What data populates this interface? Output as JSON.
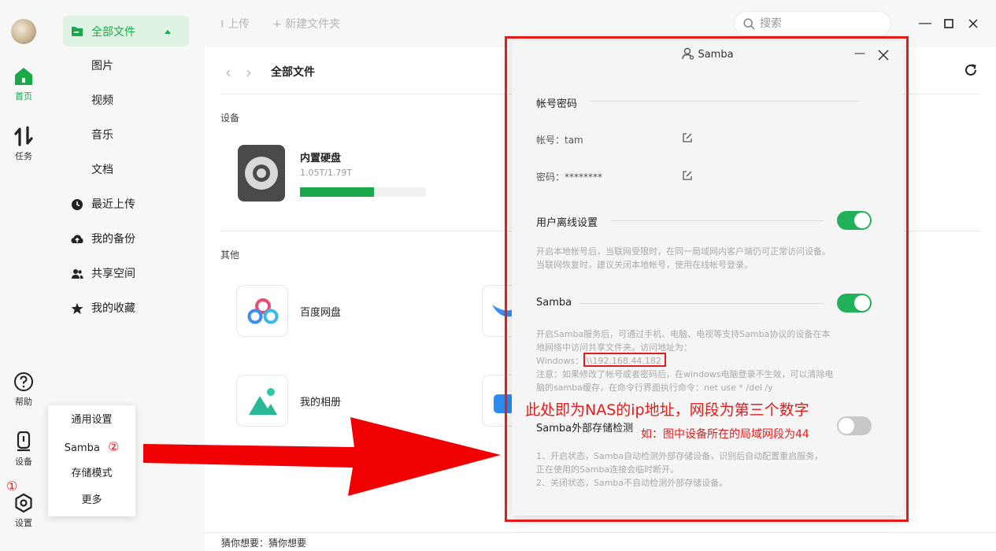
{
  "rail": {
    "items": [
      {
        "label": "首页"
      },
      {
        "label": "任务"
      },
      {
        "label": "帮助"
      },
      {
        "label": "设备"
      },
      {
        "label": "设置"
      }
    ],
    "marker_1": "①"
  },
  "sidebar": {
    "active": "全部文件",
    "sub_items": [
      "图片",
      "视频",
      "音乐",
      "文档"
    ],
    "items": [
      "最近上传",
      "我的备份",
      "共享空间",
      "我的收藏"
    ]
  },
  "toolbar": {
    "upload": "上传",
    "new_folder": "新建文件夹",
    "search_placeholder": "搜索"
  },
  "content": {
    "breadcrumb": "全部文件",
    "devices_section": "设备",
    "disk_name": "内置硬盘",
    "disk_usage": "1.05T/1.79T",
    "disk_fill": 0.59,
    "others_section": "其他",
    "apps": [
      "百度网盘",
      "我的相册"
    ],
    "hint": "猜你想要：猜你想要"
  },
  "popup": {
    "items": [
      "通用设置",
      "Samba",
      "存储模式",
      "更多"
    ],
    "marker_2": "②"
  },
  "dialog": {
    "title": "Samba",
    "account_section": "帐号密码",
    "account_label": "帐号：tam",
    "password_label": "密码：********",
    "offline_title": "用户离线设置",
    "offline_desc_1": "开启本地帐号后，当联网受限时，在同一局域网内客户端仍可正常访问设备。",
    "offline_desc_2": "当联网恢复时，建议关闭本地帐号，使用在线帐号登录。",
    "samba_title": "Samba",
    "samba_desc_1": "开启Samba服务后，可通过手机、电脑、电视等支持Samba协议的设备在本",
    "samba_desc_2": "地网络中访问共享文件夹。访问地址为：",
    "samba_windows": "Windows：",
    "samba_address": "\\\\192.168.44.182",
    "samba_note_1": "注意：如果修改了帐号或者密码后，在windows电脑登录不生效，可以清除电",
    "samba_note_2": "脑的samba缓存，在命令行界面执行命令：net use * /del /y",
    "external_title": "Samba外部存储检测",
    "external_desc_1": "1、开启状态，Samba自动检测外部存储设备，识别后自动配置重启服务，",
    "external_desc_2": "正在使用的Samba连接会临时断开。",
    "external_desc_3": "2、关闭状态，Samba不自动检测外部存储设备。"
  },
  "annotations": {
    "big_note": "此处即为NAS的ip地址，网段为第三个数字",
    "small_note": "如：图中设备所在的局域网段为44"
  },
  "colors": {
    "accent": "#1aa84a",
    "toggle_on": "#21b15a",
    "toggle_off": "#c8c8c8",
    "annotation_red": "#e21b1b"
  }
}
